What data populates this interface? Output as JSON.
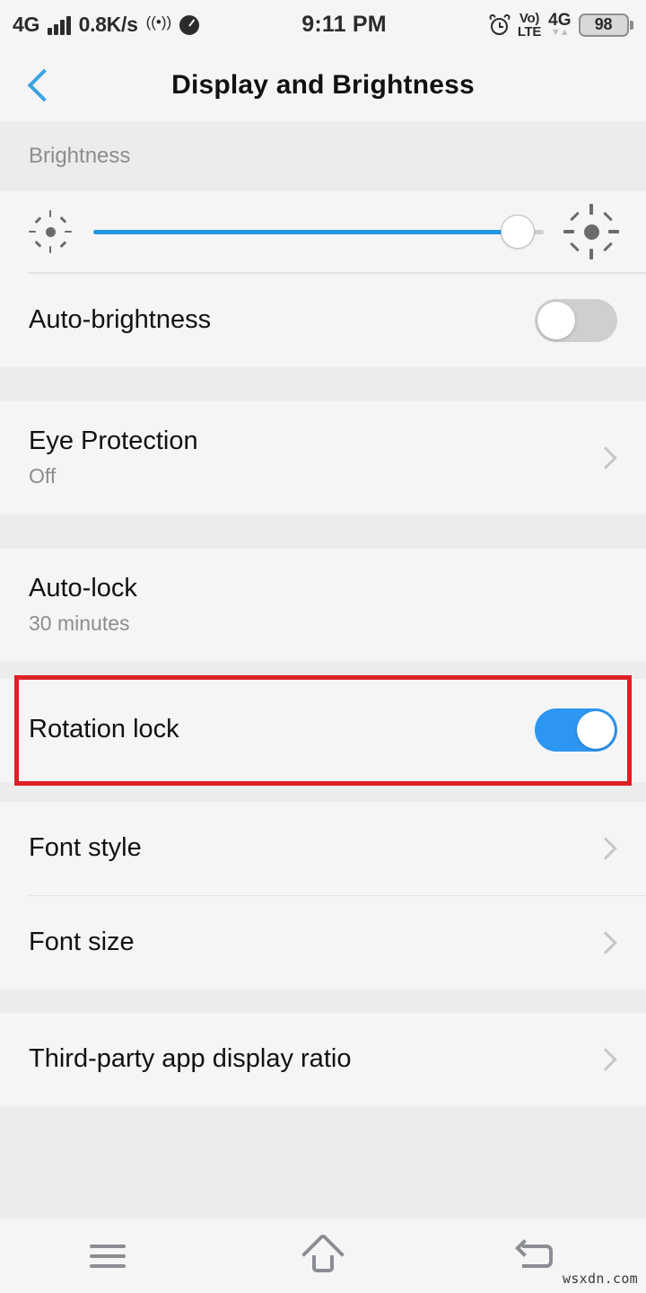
{
  "status_bar": {
    "network_label": "4G",
    "data_speed": "0.8K/s",
    "hotspot_icon": "hotspot-icon",
    "speedometer_icon": "speed-dial-icon",
    "time": "9:11 PM",
    "alarm_icon": "alarm-clock-icon",
    "volte_top": "Vo)",
    "volte_bottom": "LTE",
    "sim_network": "4G",
    "data_arrows": "▼▲",
    "battery_level": "98"
  },
  "appbar": {
    "back_icon": "back-chevron-icon",
    "title": "Display and Brightness",
    "accent_color": "#3BA3E0"
  },
  "brightness_section": {
    "header": "Brightness",
    "slider": {
      "low_icon": "sun-small-icon",
      "high_icon": "sun-large-icon",
      "value_percent": 92,
      "fill_color": "#2196E3"
    },
    "auto_brightness": {
      "label": "Auto-brightness",
      "toggle_state": "off"
    }
  },
  "rows": {
    "eye_protection": {
      "title": "Eye Protection",
      "subtitle": "Off",
      "chevron": "chevron-right-icon"
    },
    "auto_lock": {
      "title": "Auto-lock",
      "subtitle": "30 minutes"
    },
    "rotation_lock": {
      "title": "Rotation lock",
      "toggle_state": "on",
      "toggle_color": "#2D96F2",
      "highlight_color": "#DD2026"
    },
    "font_style": {
      "title": "Font style",
      "chevron": "chevron-right-icon"
    },
    "font_size": {
      "title": "Font size",
      "chevron": "chevron-right-icon"
    },
    "third_party_ratio": {
      "title": "Third-party app display ratio",
      "chevron": "chevron-right-icon"
    }
  },
  "navbar": {
    "recents_icon": "menu-icon",
    "home_icon": "home-icon",
    "back_icon": "back-arrow-icon"
  },
  "watermark": "wsxdn.com"
}
